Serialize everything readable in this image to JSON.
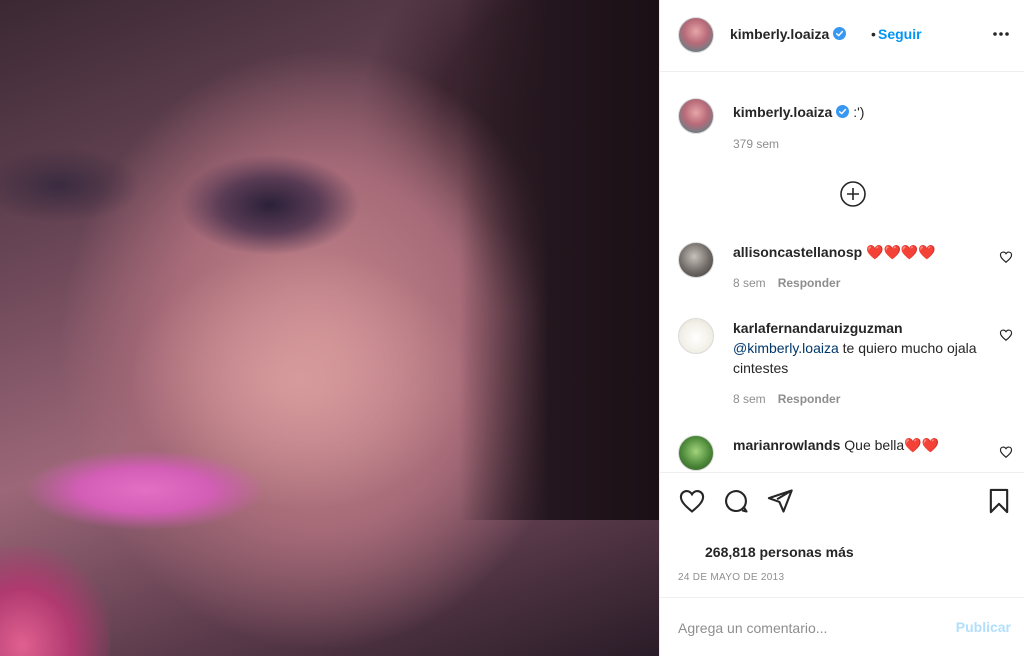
{
  "post": {
    "username": "kimberly.loaiza",
    "follow_separator": "•",
    "follow_label": "Seguir",
    "caption_text": ":')",
    "caption_time": "379 sem"
  },
  "comments": [
    {
      "username": "allisoncastellanosp",
      "text": "❤️❤️❤️❤️",
      "time": "8 sem",
      "reply": "Responder"
    },
    {
      "username": "karlafernandaruizguzman",
      "mention": "@kimberly.loaiza",
      "text": " te quiero mucho ojala cintestes",
      "time": "8 sem",
      "reply": "Responder"
    },
    {
      "username": "marianrowlands",
      "text": "Que bella❤️❤️"
    }
  ],
  "likes": "268,818 personas más",
  "date": "24 DE MAYO DE 2013",
  "composer": {
    "placeholder": "Agrega un comentario...",
    "publish_label": "Publicar"
  },
  "icons": [
    "more-options-icon",
    "verified-badge-icon",
    "load-more-icon",
    "heart-icon",
    "comment-icon",
    "share-icon",
    "bookmark-icon"
  ],
  "colors": {
    "link_blue": "#0095f6",
    "publish_disabled": "#b2dffc",
    "mention": "#00376b",
    "verified": "#3897f0"
  }
}
